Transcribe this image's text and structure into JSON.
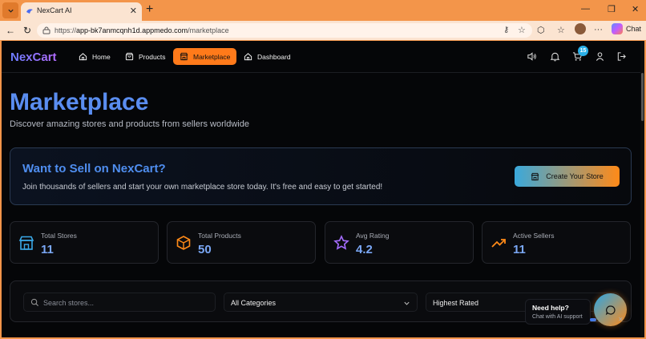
{
  "browser": {
    "tab_title": "NexCart AI",
    "url_prefix": "https://",
    "url_host": "app-bk7anmcqnh1d.appmedo.com",
    "url_path": "/marketplace",
    "copilot_label": "Chat"
  },
  "nav": {
    "brand": "NexCart",
    "items": [
      {
        "label": "Home",
        "icon": "home-icon",
        "active": false
      },
      {
        "label": "Products",
        "icon": "bag-icon",
        "active": false
      },
      {
        "label": "Marketplace",
        "icon": "store-icon",
        "active": true
      },
      {
        "label": "Dashboard",
        "icon": "home-icon",
        "active": false
      }
    ],
    "cart_count": "15"
  },
  "hero": {
    "title": "Marketplace",
    "subtitle": "Discover amazing stores and products from sellers worldwide"
  },
  "sell": {
    "title": "Want to Sell on NexCart?",
    "description": "Join thousands of sellers and start your own marketplace store today. It's free and easy to get started!",
    "button_label": "Create Your Store"
  },
  "stats": [
    {
      "label": "Total Stores",
      "value": "11",
      "icon": "store-icon",
      "color": "#3aa9e8"
    },
    {
      "label": "Total Products",
      "value": "50",
      "icon": "box-icon",
      "color": "#ff8a18"
    },
    {
      "label": "Avg Rating",
      "value": "4.2",
      "icon": "star-icon",
      "color": "#a46cff"
    },
    {
      "label": "Active Sellers",
      "value": "11",
      "icon": "trending-up-icon",
      "color": "#ff8a18"
    }
  ],
  "filters": {
    "search_placeholder": "Search stores...",
    "category_selected": "All Categories",
    "sort_selected": "Highest Rated"
  },
  "help": {
    "title": "Need help?",
    "subtitle": "Chat with AI support"
  },
  "colors": {
    "accent": "#ff7a1a",
    "brand_blue": "#5a8df0",
    "background": "#050608"
  }
}
